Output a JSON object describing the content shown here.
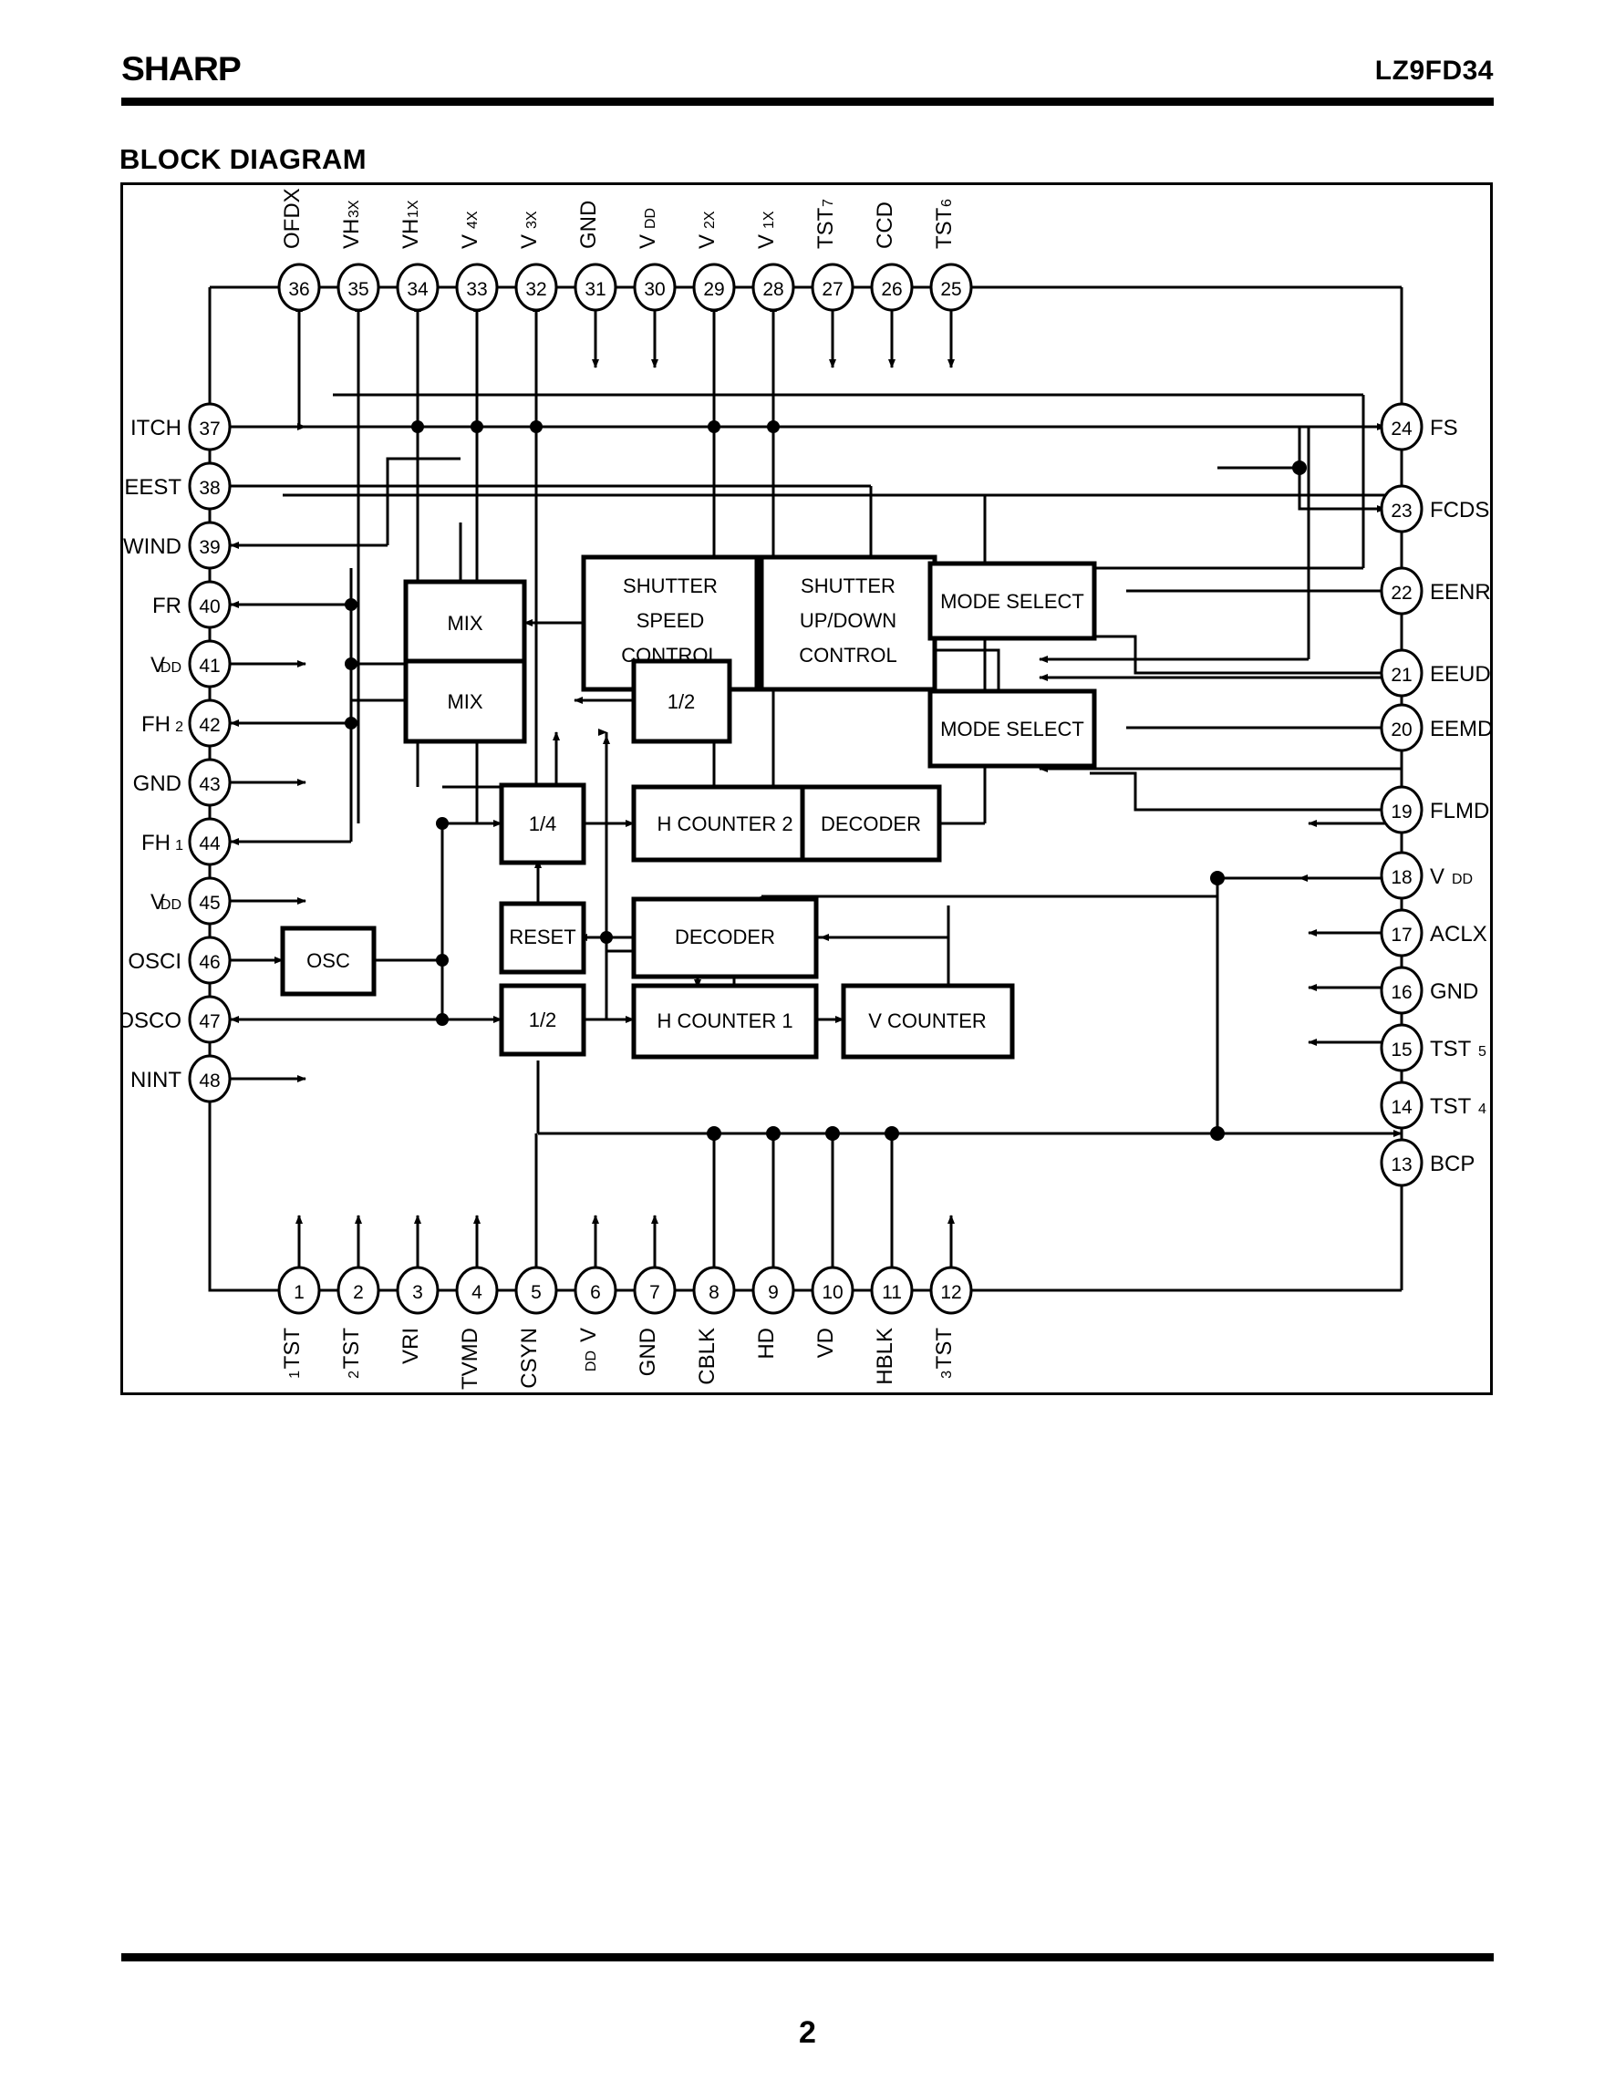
{
  "header": {
    "logo": "SHARP",
    "part_number": "LZ9FD34"
  },
  "section_title": "BLOCK DIAGRAM",
  "footer": {
    "page_number": "2"
  },
  "diagram": {
    "blocks": [
      {
        "id": "mix1",
        "label": "MIX"
      },
      {
        "id": "shutspd",
        "label": "SHUTTER SPEED CONTROL",
        "lines": [
          "SHUTTER",
          "SPEED",
          "CONTROL"
        ]
      },
      {
        "id": "shutud",
        "label": "SHUTTER UP/DOWN CONTROL",
        "lines": [
          "SHUTTER",
          "UP/DOWN",
          "CONTROL"
        ]
      },
      {
        "id": "modesel1",
        "label": "MODE SELECT"
      },
      {
        "id": "mix2",
        "label": "MIX"
      },
      {
        "id": "half1",
        "label": "1/2"
      },
      {
        "id": "modesel2",
        "label": "MODE SELECT"
      },
      {
        "id": "quarter",
        "label": "1/4"
      },
      {
        "id": "hcount2",
        "label": "H COUNTER 2"
      },
      {
        "id": "decoder1",
        "label": "DECODER"
      },
      {
        "id": "reset",
        "label": "RESET"
      },
      {
        "id": "decoder2",
        "label": "DECODER"
      },
      {
        "id": "osc",
        "label": "OSC"
      },
      {
        "id": "half2",
        "label": "1/2"
      },
      {
        "id": "hcount1",
        "label": "H COUNTER 1"
      },
      {
        "id": "vcount",
        "label": "V COUNTER"
      }
    ],
    "pins_top": [
      {
        "num": "36",
        "name": "OFDX",
        "sub": "",
        "dir": "out"
      },
      {
        "num": "35",
        "name": "VH",
        "sub": "3X",
        "dir": "out"
      },
      {
        "num": "34",
        "name": "VH",
        "sub": "1X",
        "dir": "out"
      },
      {
        "num": "33",
        "name": "V",
        "sub": "4X",
        "dir": "out"
      },
      {
        "num": "32",
        "name": "V",
        "sub": "3X",
        "dir": "out"
      },
      {
        "num": "31",
        "name": "GND",
        "sub": "",
        "dir": "in"
      },
      {
        "num": "30",
        "name": "V",
        "sub": "DD",
        "dir": "in"
      },
      {
        "num": "29",
        "name": "V",
        "sub": "2X",
        "dir": "out"
      },
      {
        "num": "28",
        "name": "V",
        "sub": "1X",
        "dir": "out"
      },
      {
        "num": "27",
        "name": "TST",
        "sub": "7",
        "dir": "in"
      },
      {
        "num": "26",
        "name": "CCD",
        "sub": "",
        "dir": "in"
      },
      {
        "num": "25",
        "name": "TST",
        "sub": "6",
        "dir": "in"
      }
    ],
    "pins_left": [
      {
        "num": "37",
        "name": "ITCH",
        "sub": "",
        "dir": "in"
      },
      {
        "num": "38",
        "name": "EEST",
        "sub": "",
        "dir": "in"
      },
      {
        "num": "39",
        "name": "WIND",
        "sub": "",
        "dir": "out"
      },
      {
        "num": "40",
        "name": "FR",
        "sub": "",
        "dir": "out"
      },
      {
        "num": "41",
        "name": "V",
        "sub": "DD",
        "dir": "in"
      },
      {
        "num": "42",
        "name": "FH",
        "sub": "2",
        "dir": "out"
      },
      {
        "num": "43",
        "name": "GND",
        "sub": "",
        "dir": "in"
      },
      {
        "num": "44",
        "name": "FH",
        "sub": "1",
        "dir": "out"
      },
      {
        "num": "45",
        "name": "V",
        "sub": "DD",
        "dir": "in"
      },
      {
        "num": "46",
        "name": "OSCI",
        "sub": "",
        "dir": "in"
      },
      {
        "num": "47",
        "name": "OSCO",
        "sub": "",
        "dir": "out"
      },
      {
        "num": "48",
        "name": "NINT",
        "sub": "",
        "dir": "in"
      }
    ],
    "pins_right": [
      {
        "num": "24",
        "name": "FS",
        "sub": "",
        "dir": "in"
      },
      {
        "num": "23",
        "name": "FCDS",
        "sub": "",
        "dir": "in"
      },
      {
        "num": "22",
        "name": "EENR",
        "sub": "",
        "dir": "plain"
      },
      {
        "num": "21",
        "name": "EEUD",
        "sub": "",
        "dir": "plain"
      },
      {
        "num": "20",
        "name": "EEMD",
        "sub": "",
        "dir": "plain"
      },
      {
        "num": "19",
        "name": "FLMD",
        "sub": "",
        "dir": "plain"
      },
      {
        "num": "18",
        "name": "V",
        "sub": "DD",
        "dir": "out"
      },
      {
        "num": "17",
        "name": "ACLX",
        "sub": "",
        "dir": "out"
      },
      {
        "num": "16",
        "name": "GND",
        "sub": "",
        "dir": "out"
      },
      {
        "num": "15",
        "name": "TST",
        "sub": "5",
        "dir": "out"
      },
      {
        "num": "14",
        "name": "TST",
        "sub": "4",
        "dir": "out"
      },
      {
        "num": "13",
        "name": "BCP",
        "sub": "",
        "dir": "in"
      }
    ],
    "pins_bottom": [
      {
        "num": "1",
        "name": "TST",
        "sub": "1",
        "dir": "out"
      },
      {
        "num": "2",
        "name": "TST",
        "sub": "2",
        "dir": "out"
      },
      {
        "num": "3",
        "name": "VRI",
        "sub": "",
        "dir": "out"
      },
      {
        "num": "4",
        "name": "TVMD",
        "sub": "",
        "dir": "out"
      },
      {
        "num": "5",
        "name": "CSYN",
        "sub": "",
        "dir": "in"
      },
      {
        "num": "6",
        "name": "V",
        "sub": "DD",
        "dir": "out"
      },
      {
        "num": "7",
        "name": "GND",
        "sub": "",
        "dir": "out"
      },
      {
        "num": "8",
        "name": "CBLK",
        "sub": "",
        "dir": "in"
      },
      {
        "num": "9",
        "name": "HD",
        "sub": "",
        "dir": "in"
      },
      {
        "num": "10",
        "name": "VD",
        "sub": "",
        "dir": "in"
      },
      {
        "num": "11",
        "name": "HBLK",
        "sub": "",
        "dir": "in"
      },
      {
        "num": "12",
        "name": "TST",
        "sub": "3",
        "dir": "out"
      }
    ]
  }
}
